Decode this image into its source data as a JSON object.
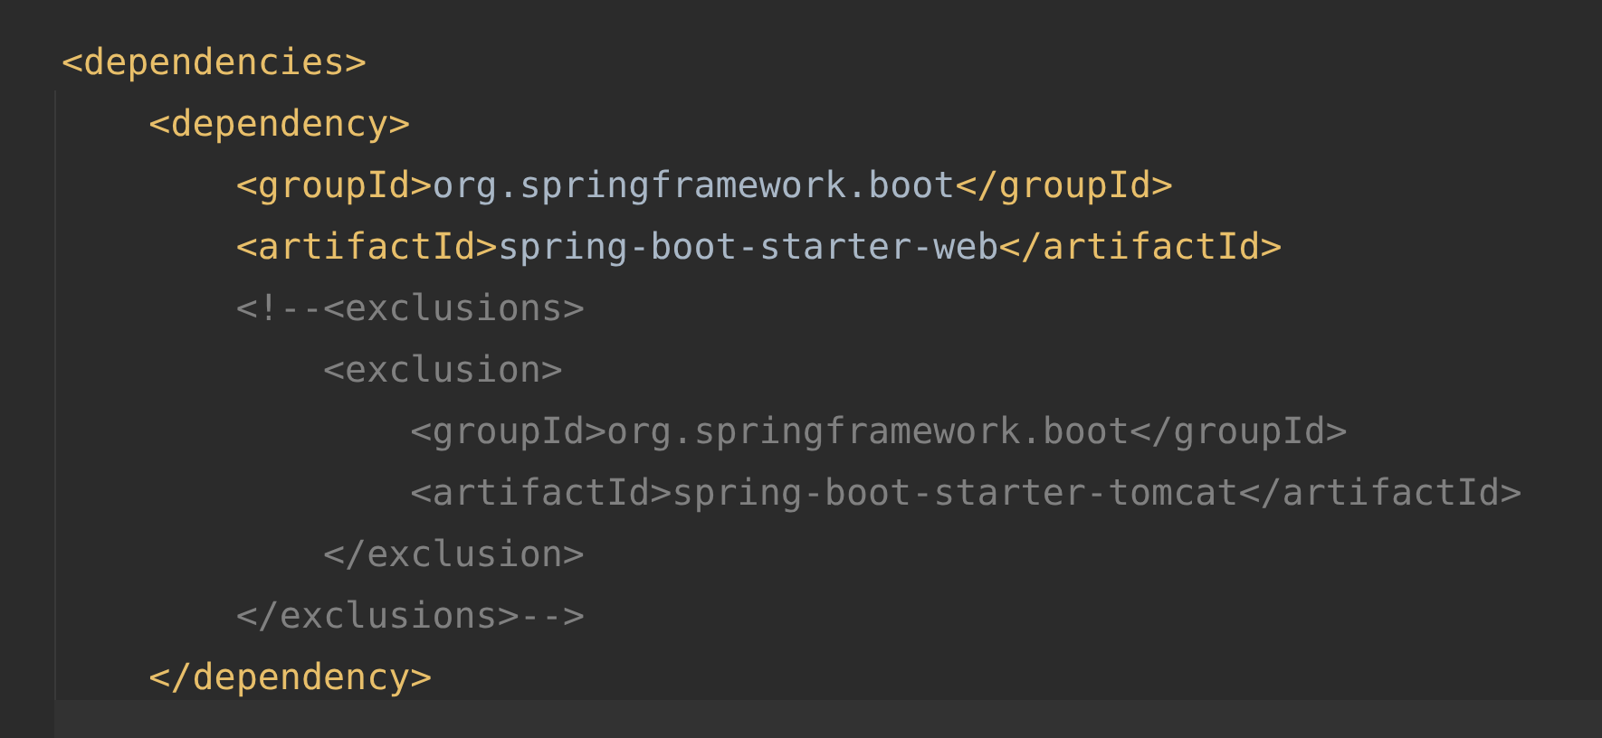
{
  "editor": {
    "lines": [
      {
        "tokens": [
          {
            "kind": "tag",
            "text": "<dependencies>"
          }
        ],
        "children": [
          {
            "tokens": [
              {
                "kind": "tag",
                "text": "<dependency>"
              }
            ],
            "children": [
              {
                "tokens": [
                  {
                    "kind": "tag",
                    "text": "<groupId>"
                  },
                  {
                    "kind": "text",
                    "text": "org.springframework.boot"
                  },
                  {
                    "kind": "tag",
                    "text": "</groupId>"
                  }
                ]
              },
              {
                "tokens": [
                  {
                    "kind": "tag",
                    "text": "<artifactId>"
                  },
                  {
                    "kind": "text",
                    "text": "spring-boot-starter-web"
                  },
                  {
                    "kind": "tag",
                    "text": "</artifactId>"
                  }
                ]
              },
              {
                "tokens": [
                  {
                    "kind": "comment",
                    "text": "<!--<exclusions>"
                  }
                ],
                "children": [
                  {
                    "tokens": [
                      {
                        "kind": "comment",
                        "text": "<exclusion>"
                      }
                    ],
                    "children": [
                      {
                        "tokens": [
                          {
                            "kind": "comment",
                            "text": "<groupId>org.springframework.boot</groupId>"
                          }
                        ]
                      },
                      {
                        "tokens": [
                          {
                            "kind": "comment",
                            "text": "<artifactId>spring-boot-starter-tomcat</artifactId>"
                          }
                        ]
                      }
                    ]
                  },
                  {
                    "tokens": [
                      {
                        "kind": "comment",
                        "text": "</exclusion>"
                      }
                    ]
                  }
                ]
              },
              {
                "tokens": [
                  {
                    "kind": "comment",
                    "text": "</exclusions>-->"
                  }
                ]
              }
            ]
          },
          {
            "tokens": [
              {
                "kind": "tag",
                "text": "</dependency>"
              }
            ]
          }
        ]
      }
    ]
  }
}
